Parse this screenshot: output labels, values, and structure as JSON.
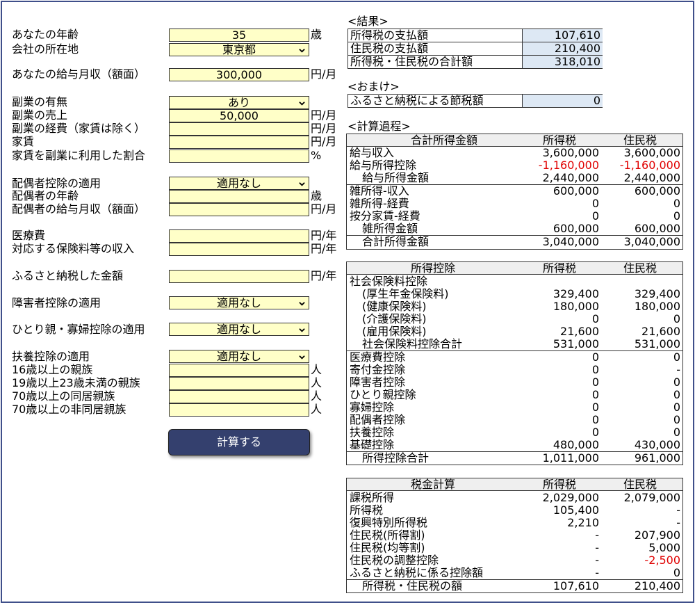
{
  "inputs": {
    "age_label": "あなたの年齢",
    "age_value": "35",
    "age_unit": "歳",
    "location_label": "会社の所在地",
    "location_value": "東京都",
    "salary_label": "あなたの給与月収（額面）",
    "salary_value": "300,000",
    "salary_unit": "円/月",
    "side_label": "副業の有無",
    "side_value": "あり",
    "side_sales_label": "副業の売上",
    "side_sales_value": "50,000",
    "side_sales_unit": "円/月",
    "side_cost_label": "副業の経費（家賃は除く）",
    "side_cost_unit": "円/月",
    "rent_label": "家賃",
    "rent_unit": "円/月",
    "rent_ratio_label": "家賃を副業に利用した割合",
    "rent_ratio_unit": "%",
    "spouse_label": "配偶者控除の適用",
    "spouse_value": "適用なし",
    "spouse_age_label": "配偶者の年齢",
    "spouse_age_unit": "歳",
    "spouse_salary_label": "配偶者の給与月収（額面）",
    "spouse_salary_unit": "円/月",
    "medical_label": "医療費",
    "medical_unit": "円/年",
    "insurance_label": "対応する保険料等の収入",
    "insurance_unit": "円/年",
    "furusato_label": "ふるさと納税した金額",
    "furusato_unit": "円/年",
    "disability_label": "障害者控除の適用",
    "disability_value": "適用なし",
    "single_parent_label": "ひとり親・寡婦控除の適用",
    "single_parent_value": "適用なし",
    "dependent_label": "扶養控除の適用",
    "dependent_value": "適用なし",
    "dep16_label": "16歳以上の親族",
    "dep19_label": "19歳以上23歳未満の親族",
    "dep70_label": "70歳以上の同居親族",
    "dep70b_label": "70歳以上の非同居親族",
    "person_unit": "人",
    "calc_button": "計算する"
  },
  "result": {
    "title": "<結果>",
    "rows": [
      {
        "label": "所得税の支払額",
        "value": "107,610"
      },
      {
        "label": "住民税の支払額",
        "value": "210,400"
      },
      {
        "label": "所得税・住民税の合計額",
        "value": "318,010"
      }
    ]
  },
  "bonus": {
    "title": "<おまけ>",
    "label": "ふるさと納税による節税額",
    "value": "0"
  },
  "process": {
    "title": "<計算過程>",
    "income": {
      "headers": [
        "合計所得金額",
        "所得税",
        "住民税"
      ],
      "rows": [
        {
          "label": "給与収入",
          "a": "3,600,000",
          "b": "3,600,000"
        },
        {
          "label": "給与所得控除",
          "a": "-1,160,000",
          "b": "-1,160,000"
        },
        {
          "label": "給与所得金額",
          "a": "2,440,000",
          "b": "2,440,000"
        },
        {
          "label": "雑所得-収入",
          "a": "600,000",
          "b": "600,000"
        },
        {
          "label": "雑所得-経費",
          "a": "0",
          "b": "0"
        },
        {
          "label": "按分家賃-経費",
          "a": "0",
          "b": "0"
        },
        {
          "label": "雑所得金額",
          "a": "600,000",
          "b": "600,000"
        },
        {
          "label": "合計所得金額",
          "a": "3,040,000",
          "b": "3,040,000"
        }
      ]
    },
    "deduction": {
      "headers": [
        "所得控除",
        "所得税",
        "住民税"
      ],
      "rows": [
        {
          "label": "社会保険料控除",
          "a": "",
          "b": ""
        },
        {
          "label": "(厚生年金保険料)",
          "a": "329,400",
          "b": "329,400"
        },
        {
          "label": "(健康保険料)",
          "a": "180,000",
          "b": "180,000"
        },
        {
          "label": "(介護保険料)",
          "a": "0",
          "b": "0"
        },
        {
          "label": "(雇用保険料)",
          "a": "21,600",
          "b": "21,600"
        },
        {
          "label": "社会保険料控除合計",
          "a": "531,000",
          "b": "531,000"
        },
        {
          "label": "医療費控除",
          "a": "0",
          "b": "0"
        },
        {
          "label": "寄付金控除",
          "a": "0",
          "b": "-"
        },
        {
          "label": "障害者控除",
          "a": "0",
          "b": "0"
        },
        {
          "label": "ひとり親控除",
          "a": "0",
          "b": "0"
        },
        {
          "label": "寡婦控除",
          "a": "0",
          "b": "0"
        },
        {
          "label": "配偶者控除",
          "a": "0",
          "b": "0"
        },
        {
          "label": "扶養控除",
          "a": "0",
          "b": "0"
        },
        {
          "label": "基礎控除",
          "a": "480,000",
          "b": "430,000"
        },
        {
          "label": "所得控除合計",
          "a": "1,011,000",
          "b": "961,000"
        }
      ]
    },
    "tax": {
      "headers": [
        "税金計算",
        "所得税",
        "住民税"
      ],
      "rows": [
        {
          "label": "課税所得",
          "a": "2,029,000",
          "b": "2,079,000"
        },
        {
          "label": "所得税",
          "a": "105,400",
          "b": "-"
        },
        {
          "label": "復興特別所得税",
          "a": "2,210",
          "b": "-"
        },
        {
          "label": "住民税(所得割)",
          "a": "-",
          "b": "207,900"
        },
        {
          "label": "住民税(均等割)",
          "a": "-",
          "b": "5,000"
        },
        {
          "label": "住民税の調整控除",
          "a": "-",
          "b": "-2,500"
        },
        {
          "label": "ふるさと納税に係る控除額",
          "a": "-",
          "b": "0"
        },
        {
          "label": "所得税・住民税の額",
          "a": "107,610",
          "b": "210,400"
        }
      ]
    }
  },
  "colors": {
    "input_bg": "#ffffc8",
    "result_bg": "#dde8f4",
    "button_bg": "#34406e",
    "negative": "#e00000",
    "frame": "#3f4f8a"
  }
}
